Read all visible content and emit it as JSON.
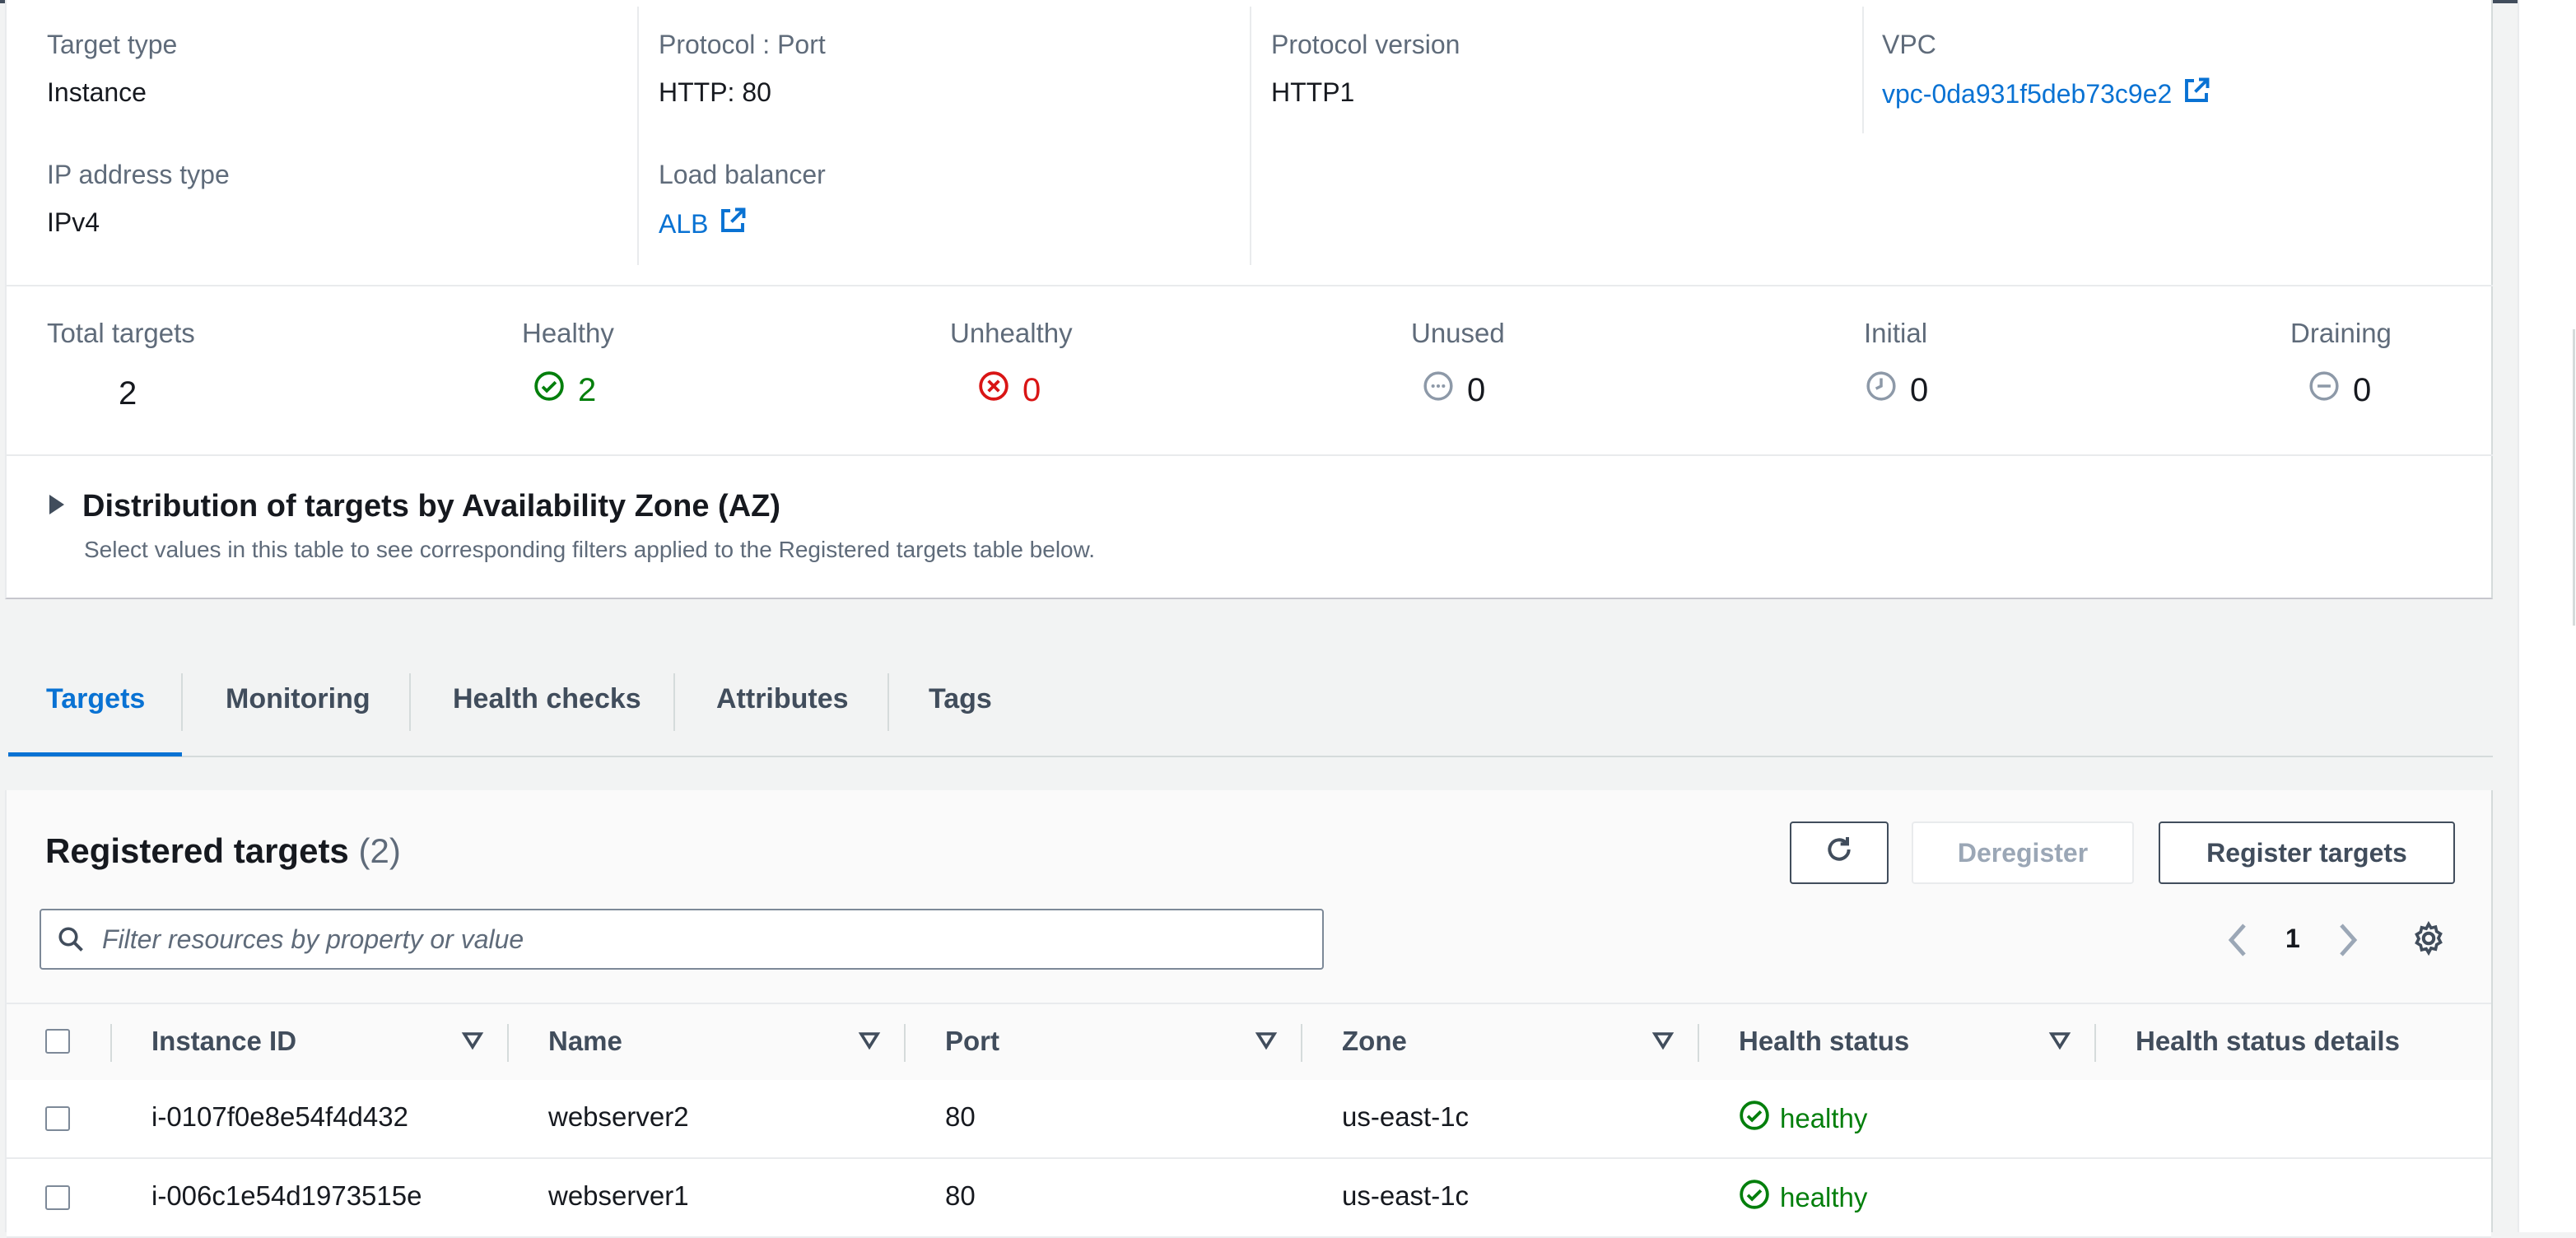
{
  "details": {
    "target_type": {
      "label": "Target type",
      "value": "Instance"
    },
    "protocol_port": {
      "label": "Protocol : Port",
      "value": "HTTP: 80"
    },
    "protocol_version": {
      "label": "Protocol version",
      "value": "HTTP1"
    },
    "vpc": {
      "label": "VPC",
      "value": "vpc-0da931f5deb73c9e2"
    },
    "ip_address_type": {
      "label": "IP address type",
      "value": "IPv4"
    },
    "load_balancer": {
      "label": "Load balancer",
      "value": "ALB"
    }
  },
  "stats": {
    "total": {
      "label": "Total targets",
      "value": "2"
    },
    "healthy": {
      "label": "Healthy",
      "value": "2"
    },
    "unhealthy": {
      "label": "Unhealthy",
      "value": "0"
    },
    "unused": {
      "label": "Unused",
      "value": "0"
    },
    "initial": {
      "label": "Initial",
      "value": "0"
    },
    "draining": {
      "label": "Draining",
      "value": "0"
    }
  },
  "az_distribution": {
    "title": "Distribution of targets by Availability Zone (AZ)",
    "subtitle": "Select values in this table to see corresponding filters applied to the Registered targets table below."
  },
  "tabs": [
    "Targets",
    "Monitoring",
    "Health checks",
    "Attributes",
    "Tags"
  ],
  "registered_targets": {
    "title": "Registered targets",
    "count": "(2)",
    "deregister_label": "Deregister",
    "register_label": "Register targets",
    "search_placeholder": "Filter resources by property or value",
    "page": "1"
  },
  "table": {
    "columns": [
      "Instance ID",
      "Name",
      "Port",
      "Zone",
      "Health status",
      "Health status details"
    ],
    "rows": [
      {
        "instance_id": "i-0107f0e8e54f4d432",
        "name": "webserver2",
        "port": "80",
        "zone": "us-east-1c",
        "health": "healthy",
        "details": ""
      },
      {
        "instance_id": "i-006c1e54d1973515e",
        "name": "webserver1",
        "port": "80",
        "zone": "us-east-1c",
        "health": "healthy",
        "details": ""
      }
    ]
  },
  "colors": {
    "link": "#0972d3",
    "healthy": "#037f0c",
    "unhealthy": "#d91515",
    "neutral": "#8d99a8"
  }
}
